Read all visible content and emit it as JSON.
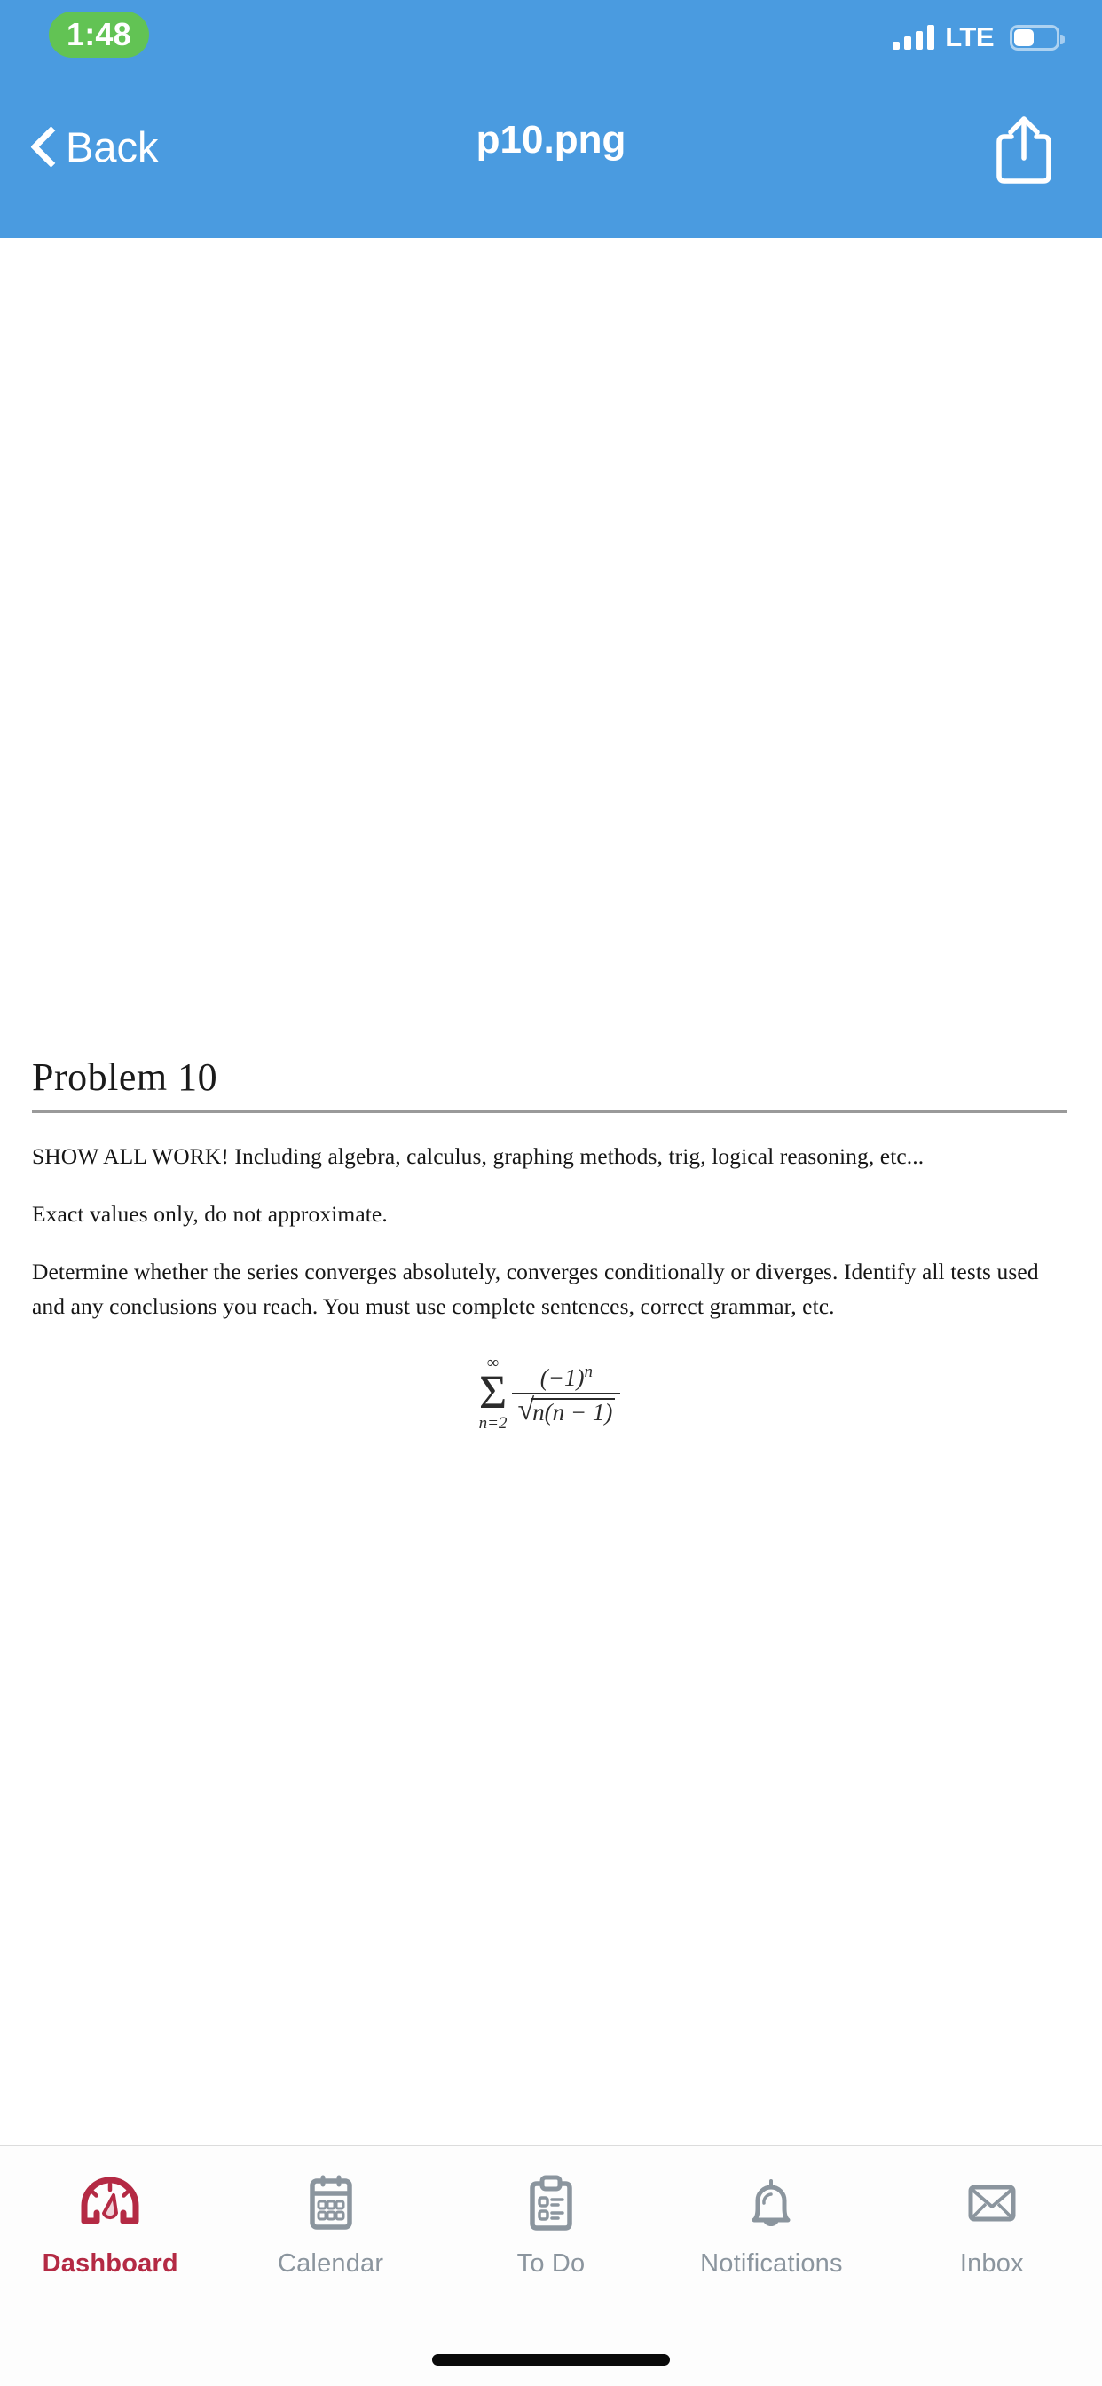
{
  "status_bar": {
    "time": "1:48",
    "time_pill_color": "#62c354",
    "carrier_network": "LTE",
    "signal_icon": "signal-bars-icon",
    "battery_icon": "battery-icon",
    "battery_level_percent": 44
  },
  "nav_bar": {
    "back_label": "Back",
    "back_icon": "chevron-left-icon",
    "title": "p10.png",
    "share_icon": "share-icon",
    "background_color": "#4a9be0"
  },
  "document": {
    "heading": "Problem 10",
    "paragraphs": [
      "SHOW ALL WORK! Including algebra, calculus, graphing methods, trig, logical reasoning, etc...",
      "Exact values only, do not approximate.",
      "Determine whether the series converges absolutely, converges conditionally or diverges. Identify all tests used and any conclusions you reach. You must use complete sentences, correct grammar, etc."
    ],
    "formula": {
      "plain_text": "sum from n=2 to infinity of (-1)^n / sqrt(n(n-1))",
      "sigma": "Σ",
      "upper_limit": "∞",
      "lower_limit": "n=2",
      "numerator": "(−1)",
      "numerator_exponent": "n",
      "radical_sign": "√",
      "radicand": "n(n − 1)"
    }
  },
  "tab_bar": {
    "active_color": "#b42a44",
    "inactive_color": "#8b959e",
    "tabs": [
      {
        "label": "Dashboard",
        "icon": "gauge-icon",
        "active": true
      },
      {
        "label": "Calendar",
        "icon": "calendar-icon",
        "active": false
      },
      {
        "label": "To Do",
        "icon": "clipboard-list-icon",
        "active": false
      },
      {
        "label": "Notifications",
        "icon": "bell-icon",
        "active": false
      },
      {
        "label": "Inbox",
        "icon": "envelope-icon",
        "active": false
      }
    ]
  },
  "home_indicator": {
    "name": "home-indicator"
  }
}
